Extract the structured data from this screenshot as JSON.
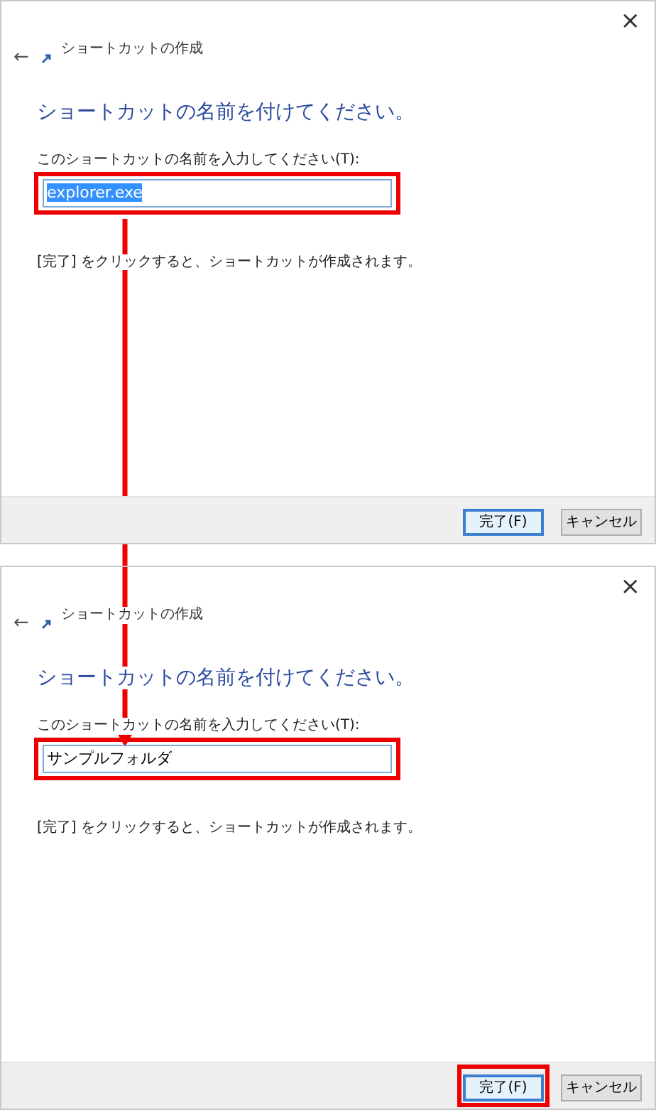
{
  "dialogs": [
    {
      "close": "×",
      "back": "←",
      "title": "ショートカットの作成",
      "heading": "ショートカットの名前を付けてください。",
      "field": {
        "label": "このショートカットの名前を入力してください(T):",
        "value": "explorer.exe",
        "selected": true,
        "highlighted": true
      },
      "instruction": "[完了] をクリックすると、ショートカットが作成されます。",
      "buttons": [
        {
          "label": "完了(F)",
          "default": true,
          "highlighted": false
        },
        {
          "label": "キャンセル",
          "default": false,
          "highlighted": false
        }
      ]
    },
    {
      "close": "×",
      "back": "←",
      "title": "ショートカットの作成",
      "heading": "ショートカットの名前を付けてください。",
      "field": {
        "label": "このショートカットの名前を入力してください(T):",
        "value": "サンプルフォルダ",
        "selected": false,
        "highlighted": true
      },
      "instruction": "[完了] をクリックすると、ショートカットが作成されます。",
      "buttons": [
        {
          "label": "完了(F)",
          "default": true,
          "highlighted": true
        },
        {
          "label": "キャンセル",
          "default": false,
          "highlighted": false
        }
      ]
    }
  ]
}
